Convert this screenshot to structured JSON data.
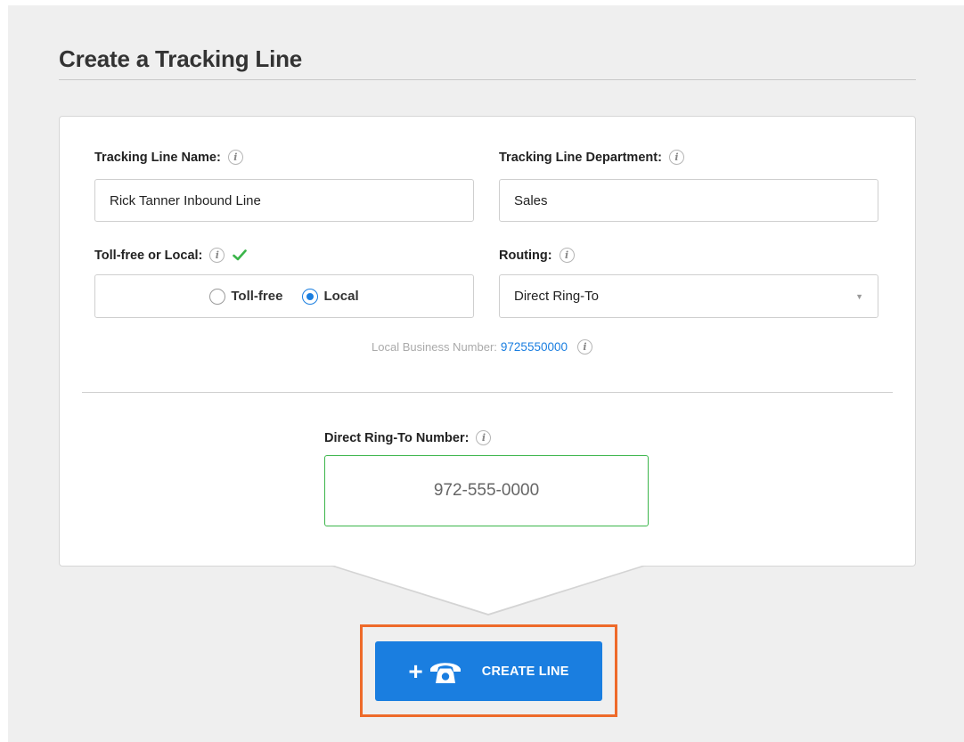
{
  "page": {
    "title": "Create a Tracking Line"
  },
  "form": {
    "name": {
      "label": "Tracking Line Name:",
      "value": "Rick Tanner Inbound Line"
    },
    "department": {
      "label": "Tracking Line Department:",
      "value": "Sales"
    },
    "type": {
      "label": "Toll-free or Local:",
      "options": [
        "Toll-free",
        "Local"
      ],
      "selected": "Local"
    },
    "routing": {
      "label": "Routing:",
      "value": "Direct Ring-To"
    },
    "business_number": {
      "label": "Local Business Number:",
      "value": "9725550000"
    },
    "ring_to": {
      "label": "Direct Ring-To Number:",
      "value": "972-555-0000"
    }
  },
  "actions": {
    "create_label": "CREATE LINE"
  },
  "colors": {
    "accent": "#1a7ee0",
    "success": "#3bb54a",
    "highlight": "#ee6a2a"
  },
  "icons": {
    "info": "info-icon",
    "check": "check-icon",
    "plus": "plus-icon",
    "phone": "phone-icon",
    "select_arrow": "chevron-down-icon"
  }
}
